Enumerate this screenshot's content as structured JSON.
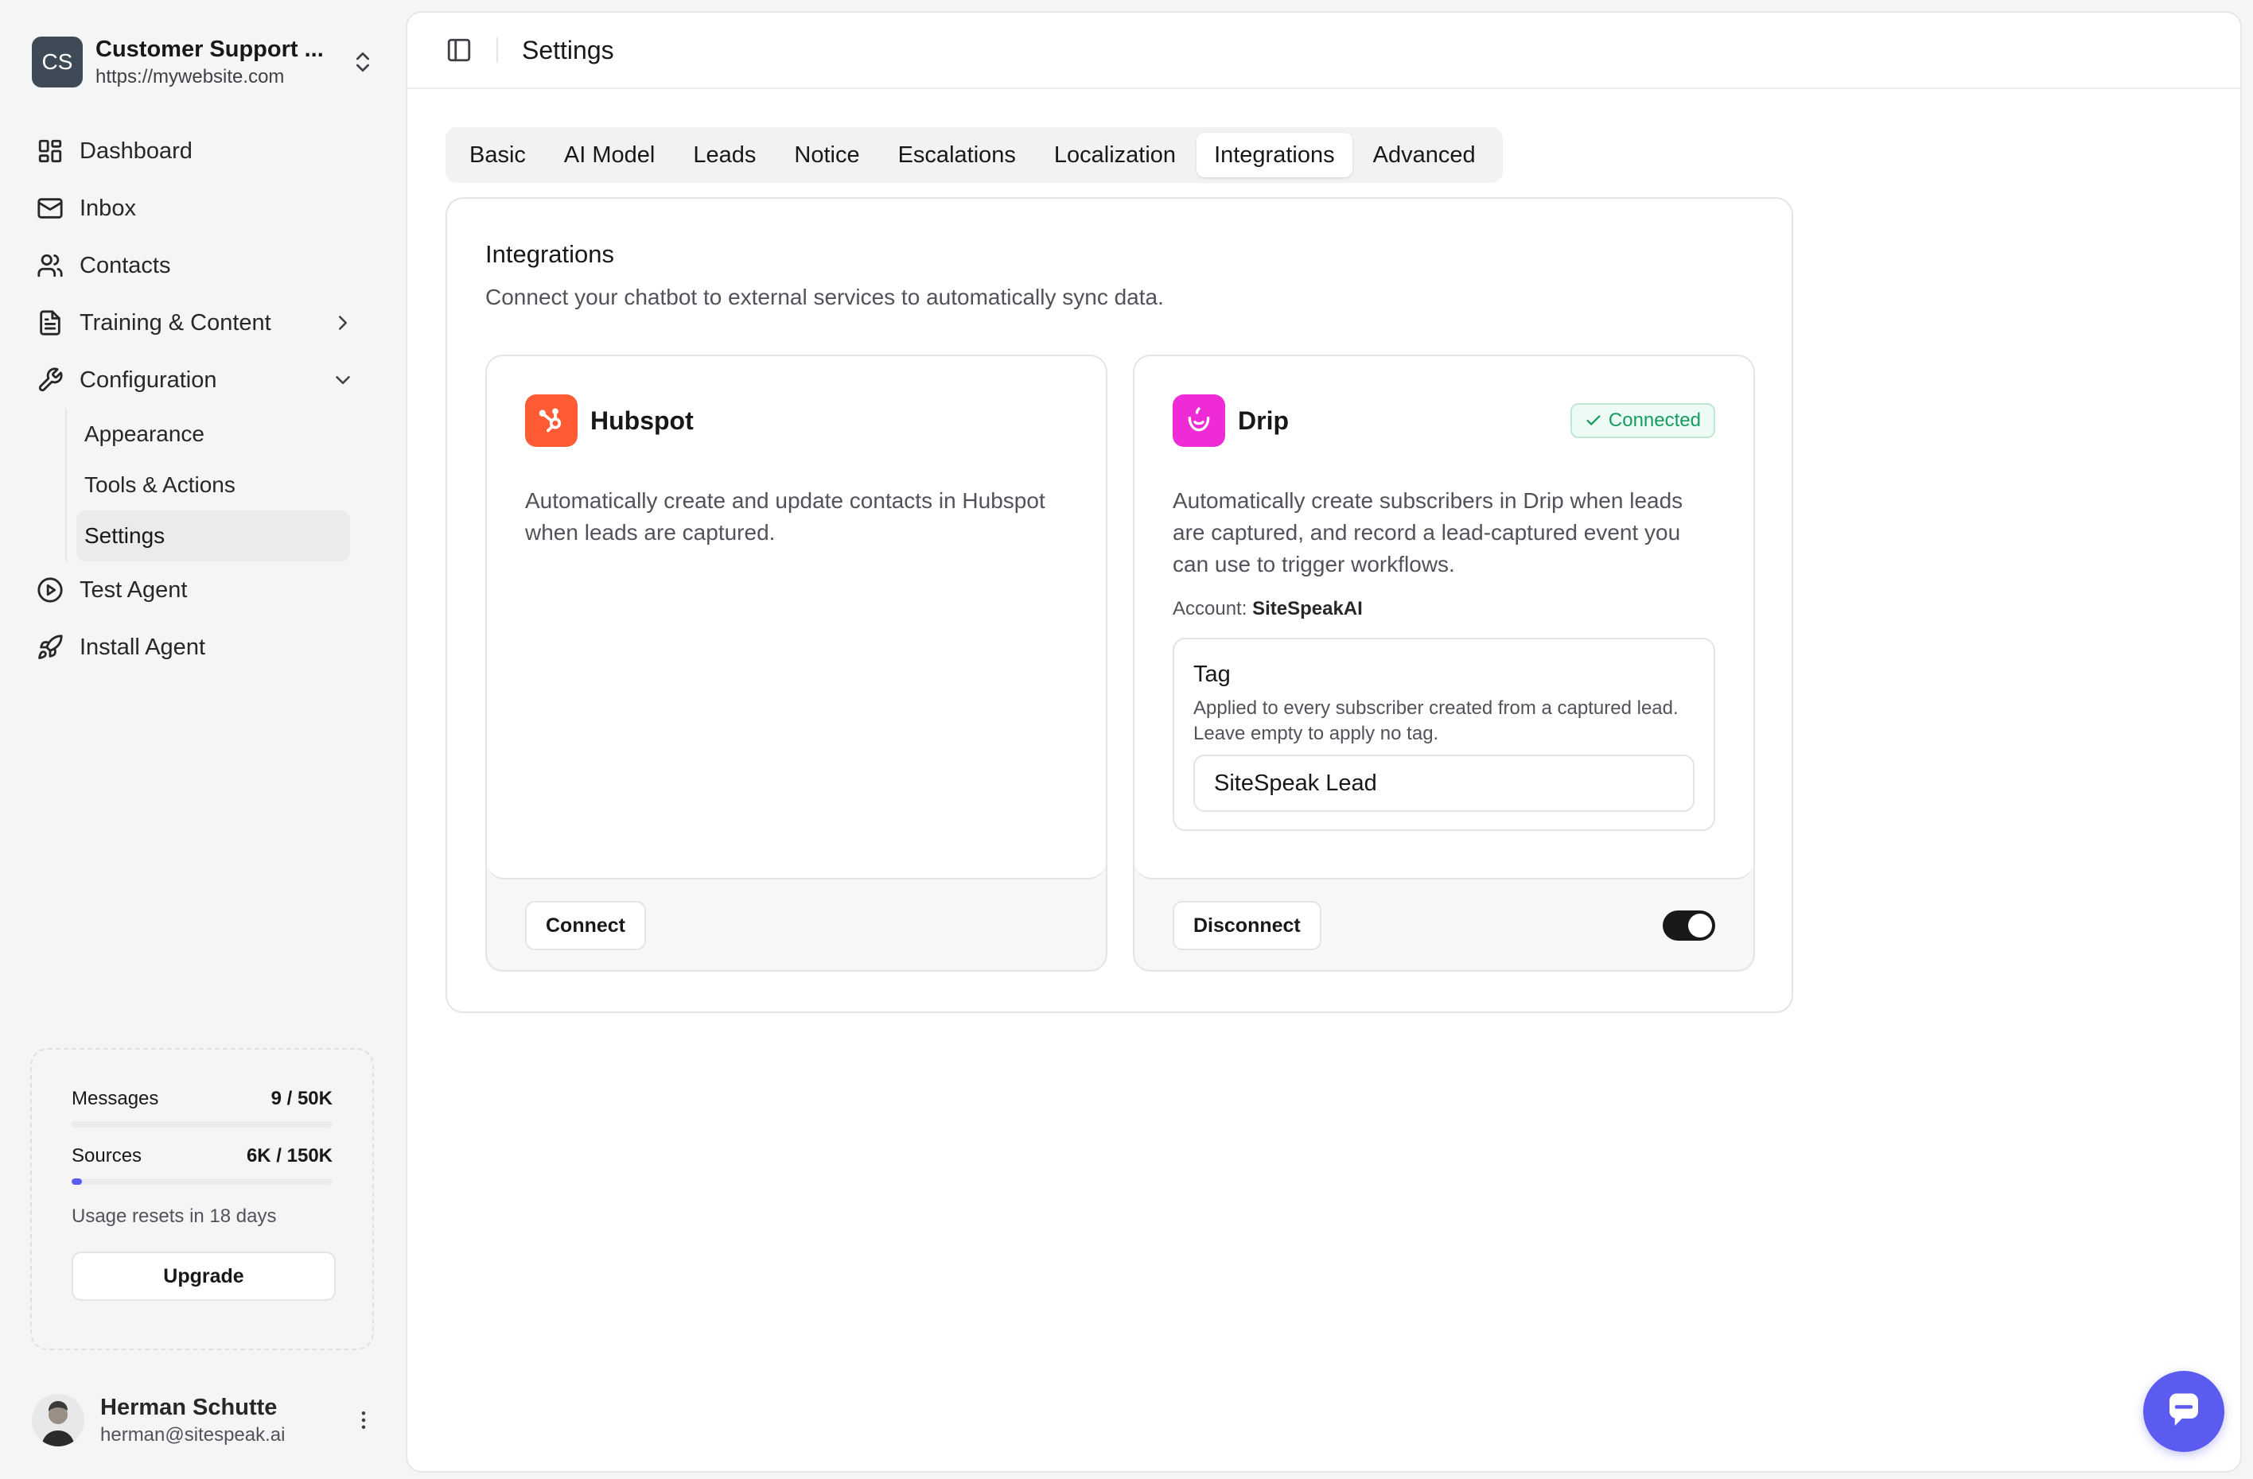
{
  "workspace": {
    "initials": "CS",
    "name": "Customer Support ...",
    "url": "https://mywebsite.com"
  },
  "nav": {
    "dashboard": "Dashboard",
    "inbox": "Inbox",
    "contacts": "Contacts",
    "training": "Training & Content",
    "configuration": "Configuration",
    "appearance": "Appearance",
    "tools": "Tools & Actions",
    "settings": "Settings",
    "test_agent": "Test Agent",
    "install_agent": "Install Agent"
  },
  "usage": {
    "messages_label": "Messages",
    "messages_value": "9 / 50K",
    "messages_fraction": 0.0002,
    "sources_label": "Sources",
    "sources_value": "6K / 150K",
    "sources_fraction": 0.04,
    "reset_text": "Usage resets in 18 days",
    "upgrade_label": "Upgrade"
  },
  "user": {
    "name": "Herman Schutte",
    "email": "herman@sitespeak.ai"
  },
  "header": {
    "title": "Settings"
  },
  "tabs": [
    "Basic",
    "AI Model",
    "Leads",
    "Notice",
    "Escalations",
    "Localization",
    "Integrations",
    "Advanced"
  ],
  "active_tab": "Integrations",
  "panel": {
    "title": "Integrations",
    "description": "Connect your chatbot to external services to automatically sync data."
  },
  "hubspot": {
    "name": "Hubspot",
    "description": "Automatically create and update contacts in Hubspot when leads are captured.",
    "button": "Connect",
    "brand_color": "#ff5c35"
  },
  "drip": {
    "name": "Drip",
    "status": "Connected",
    "description": "Automatically create subscribers in Drip when leads are captured, and record a lead-captured event you can use to trigger workflows.",
    "account_label": "Account:",
    "account_value": "SiteSpeakAI",
    "tag_title": "Tag",
    "tag_help": "Applied to every subscriber created from a captured lead. Leave empty to apply no tag.",
    "tag_value": "SiteSpeak Lead",
    "button": "Disconnect",
    "enabled": true,
    "brand_color": "#ee2bd6"
  },
  "colors": {
    "accent": "#5b5bf0",
    "success": "#169c5f",
    "sidebar_bg": "#f5f5f6"
  }
}
